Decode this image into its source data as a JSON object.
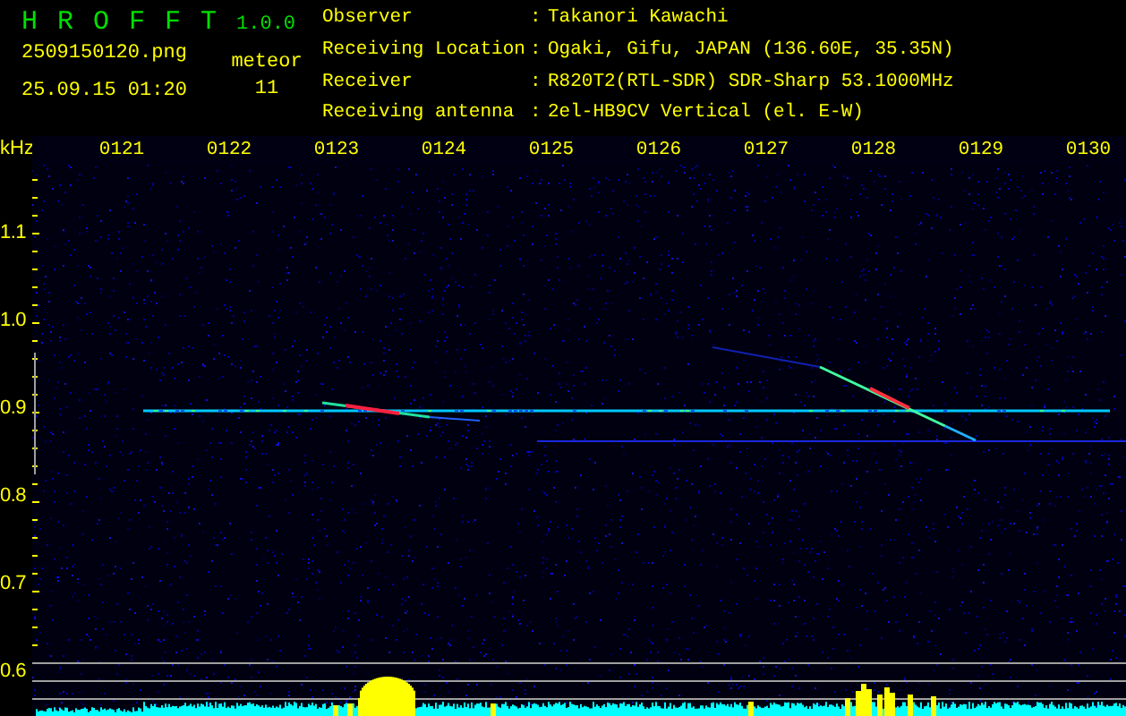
{
  "app": {
    "title": "H R O F F T",
    "version": "1.0.0"
  },
  "file": {
    "name": "2509150120.png",
    "datetime": "25.09.15 01:20"
  },
  "counter": {
    "label": "meteor",
    "value": "11"
  },
  "info": [
    {
      "label": "Observer",
      "separator": ":",
      "value": "Takanori Kawachi"
    },
    {
      "label": "Receiving Location",
      "separator": ":",
      "value": "Ogaki, Gifu, JAPAN (136.60E, 35.35N)"
    },
    {
      "label": "Receiver",
      "separator": ":",
      "value": "R820T2(RTL-SDR) SDR-Sharp 53.1000MHz"
    },
    {
      "label": "Receiving antenna",
      "separator": ":",
      "value": "2el-HB9CV Vertical (el. E-W)"
    }
  ],
  "plot": {
    "unit": "kHz",
    "time_labels": [
      "0121",
      "0122",
      "0123",
      "0124",
      "0125",
      "0126",
      "0127",
      "0128",
      "0129",
      "0130"
    ],
    "frequency_labels": [
      "1.1",
      "1.0",
      "0.9",
      "0.8",
      "0.7",
      "0.6"
    ]
  }
}
